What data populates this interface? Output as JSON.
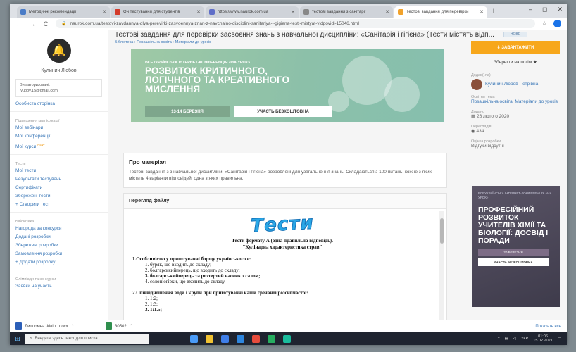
{
  "browser": {
    "tabs": [
      {
        "label": "Методичні рекомендації",
        "color": "#4a7cc7",
        "active": false
      },
      {
        "label": "Он тестування для студентів",
        "color": "#d33b2b",
        "active": false
      },
      {
        "label": "https://www.naurok.com.ua",
        "color": "#5f6ec8",
        "active": false
      },
      {
        "label": "тестові завдання з санітарії",
        "color": "#888888",
        "active": false
      },
      {
        "label": "Тестові завдання для перевірки",
        "color": "#f1a22b",
        "active": true
      }
    ],
    "new_tab": "+",
    "window_controls": [
      "–",
      "◻",
      "✕"
    ],
    "url": "naurok.com.ua/testovi-zavdannya-dlya-perevirki-zasvoennya-znan-z-navchalno-disciplini-sanitariya-i-gigiena-testi-mistyat-vidpovidi-15046.html",
    "nav": [
      "←",
      "→",
      "C"
    ]
  },
  "sidebar": {
    "user_name": "Кулинич Любов",
    "user_label": "Ви авторизовані:",
    "user_email": "lyubov.15@gmail.com",
    "personal_page": "Особиста сторінка",
    "section_events": "Підвищення кваліфікації",
    "events": [
      "Мої вебінари",
      "Мої конференції",
      "Мої курси"
    ],
    "new_badge": "NEW",
    "section_tests": "Тести",
    "tests": [
      "Мої тести",
      "Результати тестувань",
      "Сертифікати",
      "Збережені тести"
    ],
    "create_test": "+ Створити тест",
    "section_library": "Бібліотека",
    "library": [
      "Нагорода за конкурси",
      "Додані розробки",
      "Збережені розробки",
      "Замовлення розробки"
    ],
    "add_dev": "+ Додати розробку",
    "section_olymp": "Олімпіади та конкурси",
    "olymp": [
      "Заявки на участь"
    ]
  },
  "main": {
    "title": "Тестові завдання для перевірки засвоєння знань з навчальної дисципліни: «Санітарія і гігієна» (Тести містять відп...",
    "breadcrumb": "Бібліотека › Позашкільна освіта › Матеріали до уроків",
    "banner": {
      "subtitle": "ВСЕУКРАЇНСЬКА ІНТЕРНЕТ-КОНФЕРЕНЦІЯ «НА УРОК»",
      "title": "РОЗВИТОК КРИТИЧНОГО, ЛОГІЧНОГО ТА КРЕАТИВНОГО МИСЛЕННЯ",
      "date": "13-14 БЕРЕЗНЯ",
      "button": "УЧАСТЬ БЕЗКОШТОВНА"
    },
    "about_title": "Про матеріал",
    "about_text": "Тестові завдання з з навчальної дисципліни: «Санітарія і гігієна» розроблені для узагальнення знань. Складаються з 100 питань, кожне з яких містить 4 варіанти відповідей, одна з яких правильна.",
    "preview_title": "Перегляд файлу",
    "doc": {
      "wordart": "Тести",
      "heading1": "Тести формату А (одна правильна відповідь).",
      "heading2": "\"Кулінарна характеристика страв\"",
      "q1": "1.Особливістю у приготуванні борщу українського є:",
      "q1_opts": [
        "1.   буряк, що входить до складу;",
        "2.   болгарськийперець, що входить до складу;",
        "3.   болгарськийперець та розтертий часник з салом;",
        "4.   солоніогірки, що входить до складу."
      ],
      "q1_bold": 2,
      "q2": "2.Співвідношення води і крупи при приготуванні каши гречаної розсипчастої:",
      "q2_opts": [
        "1.   1:2;",
        "2.   1:3;",
        "3.   1:1.5;"
      ],
      "q2_bold": 2
    }
  },
  "right": {
    "top_badge": "НОВЕ",
    "download": "⬇ ЗАВАНТАЖИТИ",
    "save": "Зберегти на потім ★",
    "author_label": "Додав(-ла)",
    "author_name": "Кулинич Любов Петрівна",
    "section_label": "Освітня тема",
    "section_value": "Позашкільна освіта, Матеріали до уроків",
    "added_label": "Додано",
    "added_value": "26 лютого 2020",
    "views_label": "Переглядів",
    "views_value": "434",
    "rating_label": "Оцінка розробки",
    "rating_value": "Відгуки відсутні",
    "ad": {
      "subtitle": "ВСЕУКРАЇНСЬКА ІНТЕРНЕТ-КОНФЕРЕНЦІЯ «НА УРОК»",
      "title": "ПРОФЕСІЙНИЙ РОЗВИТОК УЧИТЕЛІВ ХІМІЇ ТА БІОЛОГІЇ: ДОСВІД І ПОРАДИ",
      "date": "20 БЕРЕЗНЯ",
      "button": "УЧАСТЬ БЕЗКОШТОВНА"
    }
  },
  "downloads": {
    "items": [
      {
        "name": "Дипломна Філіп...docx",
        "color": "#2c5fb8"
      },
      {
        "name": "30502",
        "color": "#2f8f4e"
      }
    ],
    "show_all": "Показать все"
  },
  "taskbar": {
    "search_placeholder": "Введите здесь текст для поиска",
    "time": "01:06",
    "date": "15.02.2021",
    "lang": "УКР",
    "app_colors": [
      "#4a9bf7",
      "#f1c232",
      "#3f7ee8",
      "#2e86de",
      "#e74c3c",
      "#27ae60",
      "#1abc9c"
    ]
  }
}
